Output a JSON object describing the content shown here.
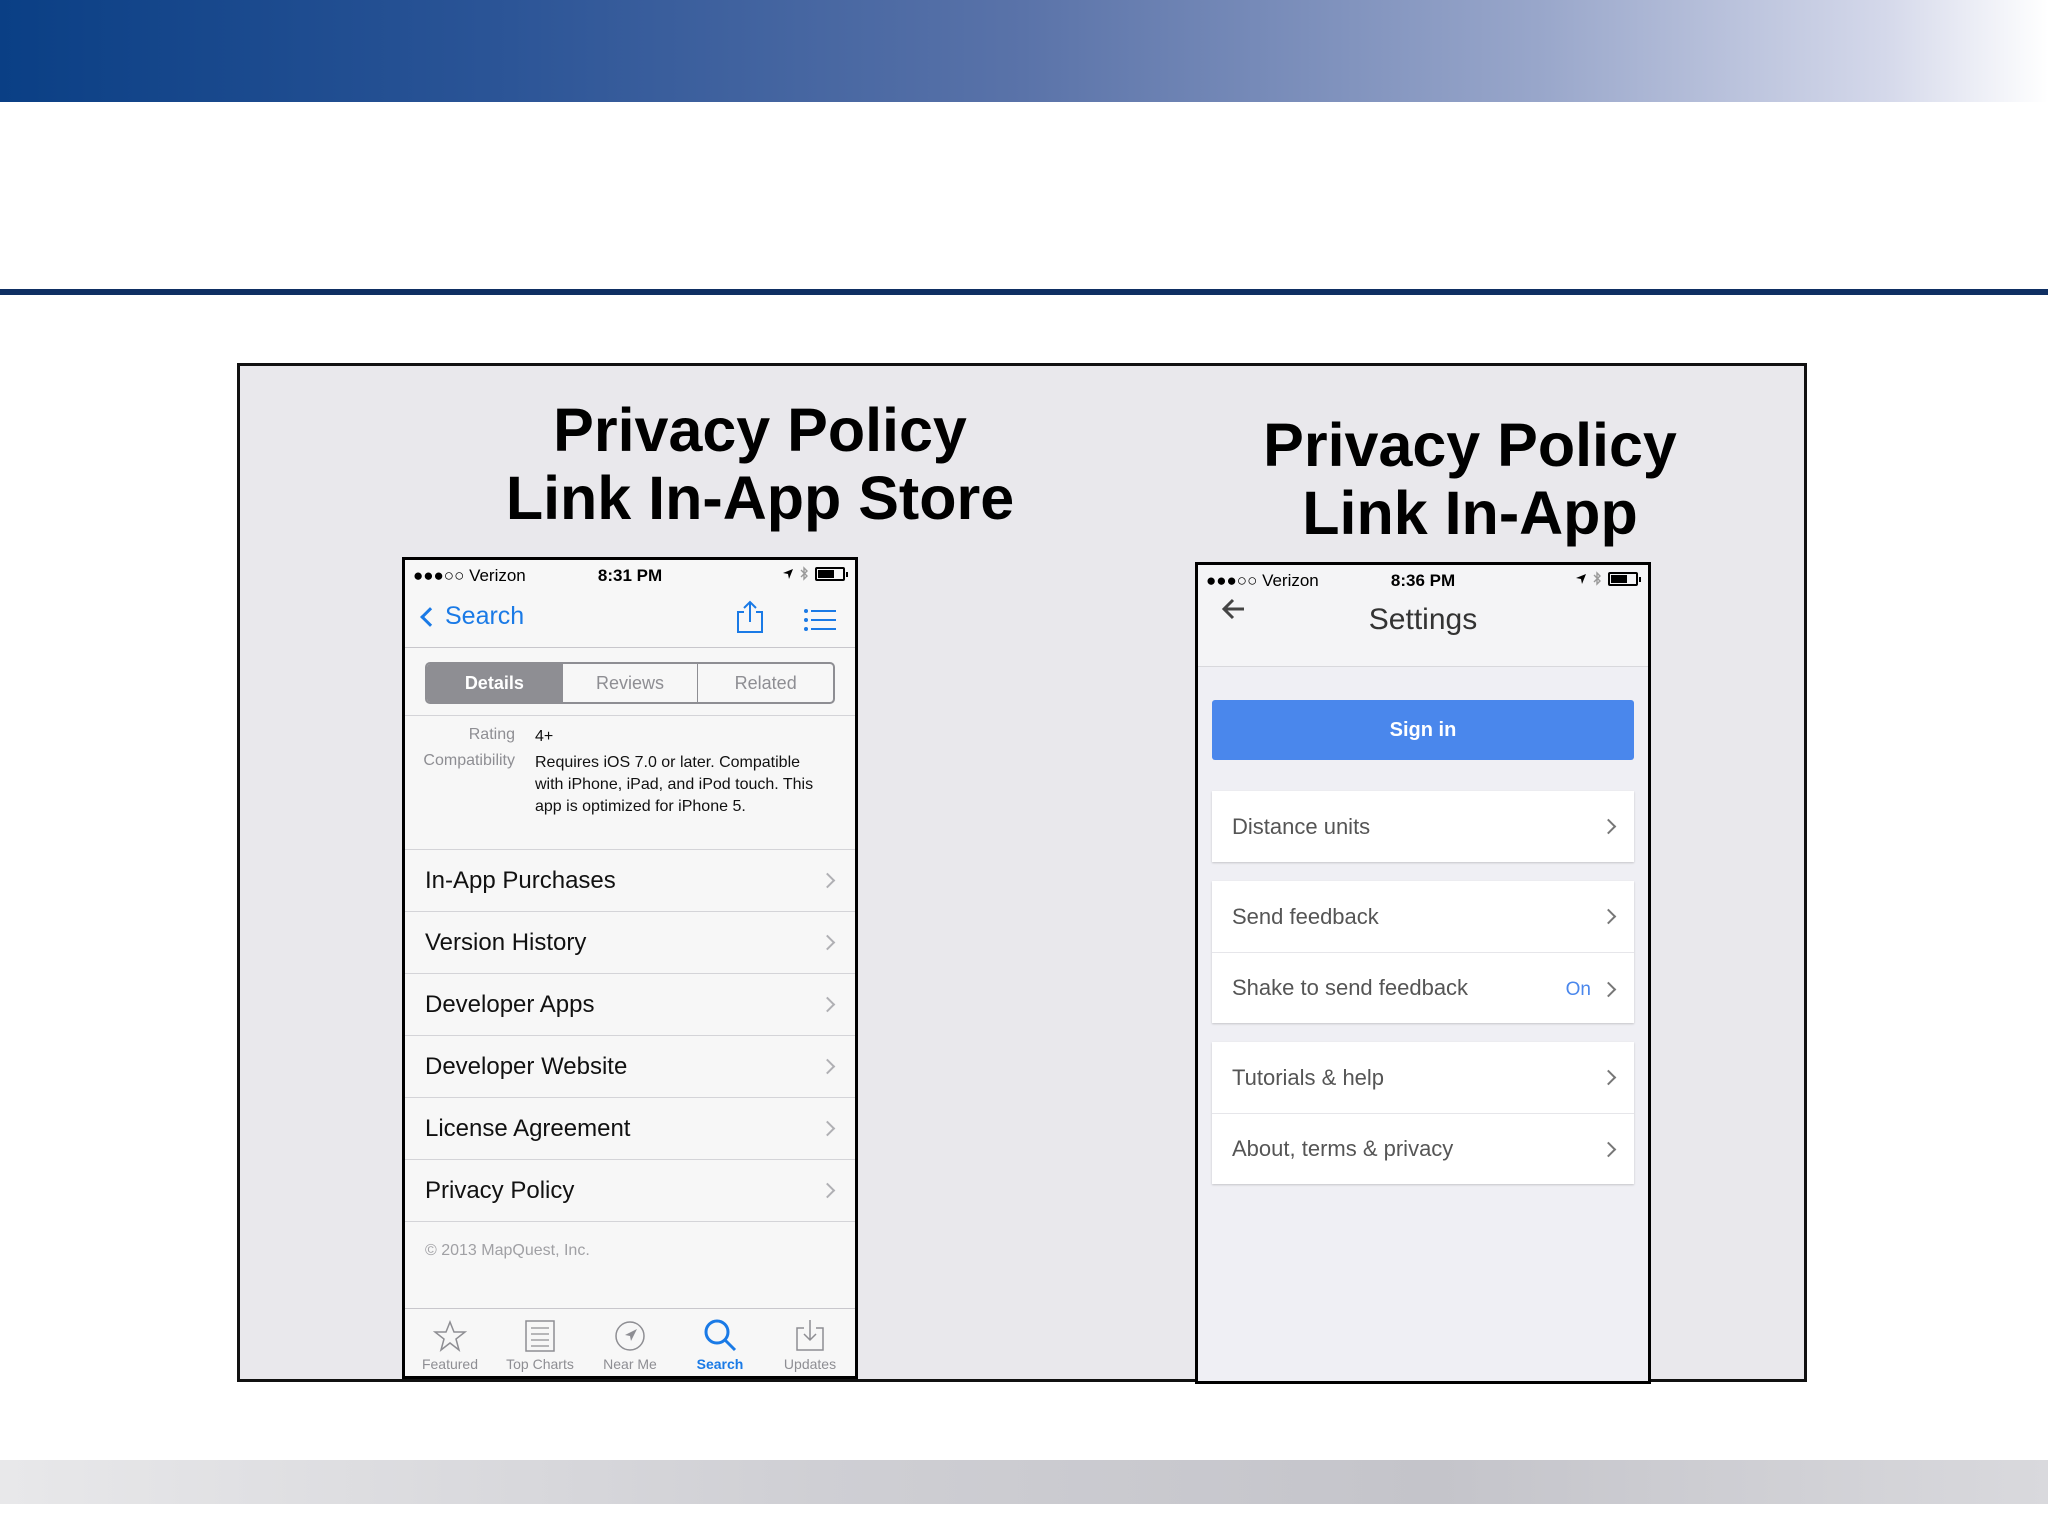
{
  "left": {
    "title_line1": "Privacy Policy",
    "title_line2": "Link In-App Store",
    "status": {
      "carrier": "●●●○○ Verizon",
      "time": "8:31 PM"
    },
    "nav": {
      "back_label": "Search"
    },
    "segments": [
      "Details",
      "Reviews",
      "Related"
    ],
    "info": {
      "rating_key": "Rating",
      "rating_value": "4+",
      "compat_key": "Compatibility",
      "compat_value": "Requires iOS 7.0 or later. Compatible with iPhone, iPad, and iPod touch. This app is optimized for iPhone 5."
    },
    "rows": [
      "In-App Purchases",
      "Version History",
      "Developer Apps",
      "Developer Website",
      "License Agreement",
      "Privacy Policy"
    ],
    "copyright": "© 2013 MapQuest, Inc.",
    "tabs": [
      "Featured",
      "Top Charts",
      "Near Me",
      "Search",
      "Updates"
    ],
    "accent": "#1a7ae6"
  },
  "right": {
    "title_line1": "Privacy Policy",
    "title_line2": "Link In-App",
    "status": {
      "carrier": "●●●○○ Verizon",
      "time": "8:36 PM"
    },
    "header_title": "Settings",
    "signin_label": "Sign in",
    "distance_units": "Distance units",
    "send_feedback": "Send feedback",
    "shake_feedback": "Shake to send feedback",
    "shake_value": "On",
    "tutorials": "Tutorials & help",
    "about": "About, terms & privacy",
    "accent": "#4a87ec"
  }
}
